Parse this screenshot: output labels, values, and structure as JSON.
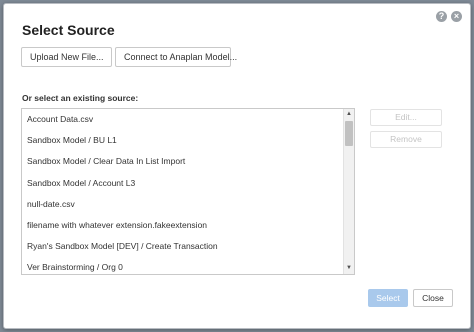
{
  "dialog": {
    "title": "Select Source",
    "help_icon": "?",
    "close_icon": "×"
  },
  "toolbar": {
    "upload_label": "Upload New File...",
    "connect_label": "Connect to Anaplan Model..."
  },
  "existing": {
    "label": "Or select an existing source:",
    "items": [
      "Account Data.csv",
      "Sandbox Model / BU L1",
      "Sandbox Model / Clear Data In List Import",
      "Sandbox Model / Account L3",
      "null-date.csv",
      "filename with whatever extension.fakeextension",
      "Ryan's Sandbox Model [DEV] / Create Transaction",
      "Ver Brainstorming / Org 0"
    ],
    "scroll_up_icon": "▲",
    "scroll_down_icon": "▼"
  },
  "side_buttons": {
    "edit_label": "Edit...",
    "remove_label": "Remove"
  },
  "footer": {
    "select_label": "Select",
    "close_label": "Close"
  },
  "colors": {
    "primary_disabled": "#a9c9ec",
    "backdrop": "#7f8a96"
  }
}
